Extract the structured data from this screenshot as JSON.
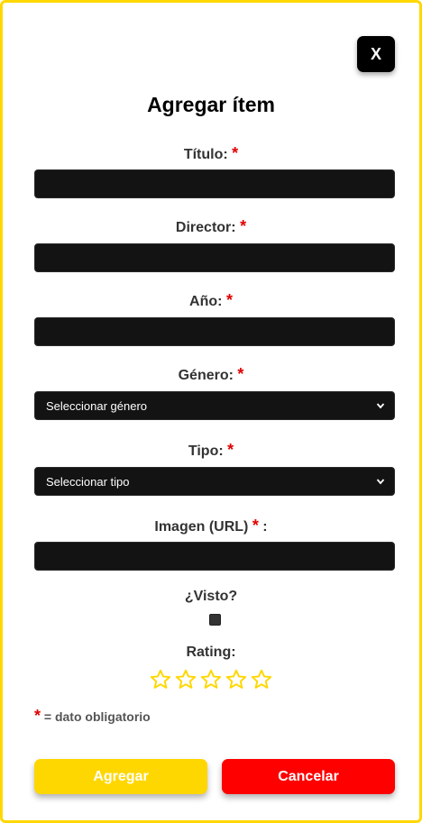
{
  "modal": {
    "close_label": "X",
    "title": "Agregar ítem",
    "required_mark": "*"
  },
  "fields": {
    "titulo": {
      "label": "Título:",
      "value": ""
    },
    "director": {
      "label": "Director:",
      "value": ""
    },
    "anio": {
      "label": "Año:",
      "value": ""
    },
    "genero": {
      "label": "Género:",
      "selected": "Seleccionar género"
    },
    "tipo": {
      "label": "Tipo:",
      "selected": "Seleccionar tipo"
    },
    "imagen": {
      "label": "Imagen (URL)",
      "label_suffix": ":",
      "value": ""
    },
    "visto": {
      "label": "¿Visto?",
      "checked": false
    },
    "rating": {
      "label": "Rating:",
      "value": 0,
      "max": 5
    }
  },
  "note": {
    "mark": "*",
    "text": "= dato obligatorio"
  },
  "actions": {
    "add_label": "Agregar",
    "cancel_label": "Cancelar"
  },
  "colors": {
    "accent": "#FFD700",
    "danger": "#FF0000",
    "input_bg": "#131313",
    "required": "#E00000"
  }
}
